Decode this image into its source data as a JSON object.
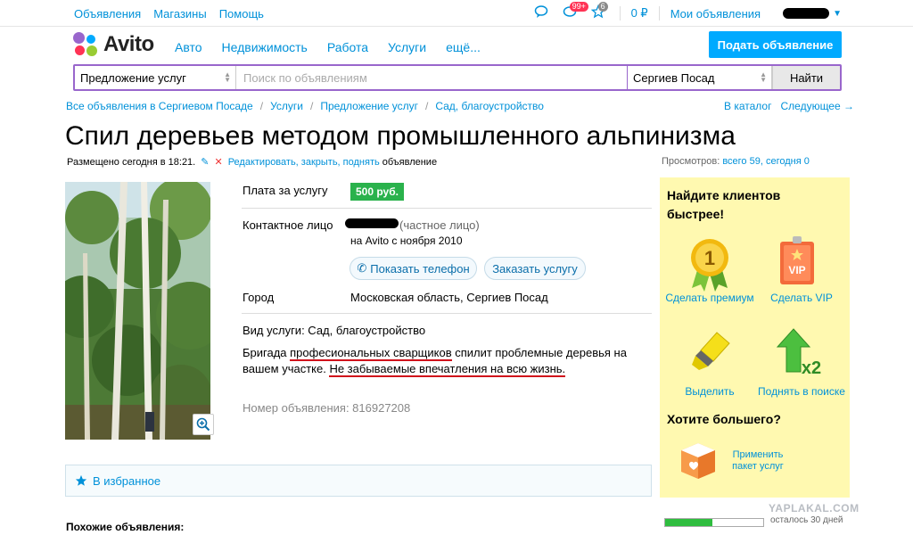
{
  "topbar": {
    "links": [
      "Объявления",
      "Магазины",
      "Помощь"
    ],
    "notif_badge": "99+",
    "fav_badge": "6",
    "balance": "0 ₽",
    "my_ads": "Мои объявления"
  },
  "header": {
    "logo_text": "Avito",
    "nav": [
      "Авто",
      "Недвижимость",
      "Работа",
      "Услуги",
      "ещё..."
    ],
    "post_button": "Подать объявление"
  },
  "search": {
    "category": "Предложение услуг",
    "placeholder": "Поиск по объявлениям",
    "location": "Сергиев Посад",
    "button": "Найти"
  },
  "breadcrumbs": [
    "Все объявления в Сергиевом Посаде",
    "Услуги",
    "Предложение услуг",
    "Сад, благоустройство"
  ],
  "breadcrumbs_right": [
    "В каталог",
    "Следующее →"
  ],
  "ad": {
    "title": "Спил деревьев методом промышленного альпинизма",
    "placed": "Размещено сегодня в 18:21.",
    "edit_link": "Редактировать, закрыть, поднять",
    "edit_suffix": "объявление",
    "views_label": "Просмотров:",
    "views_value": "всего 59, сегодня 0",
    "price_label": "Плата за услугу",
    "price": "500 руб.",
    "contact_label": "Контактное лицо",
    "contact_type": "(частное лицо)",
    "contact_since": "на Avito с ноября 2010",
    "show_phone": "Показать телефон",
    "order": "Заказать услугу",
    "city_label": "Город",
    "city": "Московская область, Сергиев Посад",
    "service_type": "Вид услуги: Сад, благоустройство",
    "desc_p1": "Бригада ",
    "desc_u1": "професиональных сварщиков",
    "desc_p2": " спилит проблемные деревья на вашем участке. ",
    "desc_u2": "Не забываемые впечатления на всю жизнь.",
    "ad_number": "Номер объявления: 816927208",
    "favorites": "В избранное",
    "similar": "Похожие объявления:"
  },
  "promo": {
    "heading": "Найдите клиентов быстрее!",
    "premium": "Сделать премиум",
    "vip": "Сделать VIP",
    "vip_badge": "VIP",
    "highlight": "Выделить",
    "raise": "Поднять в поиске",
    "raise_mult": "x2",
    "heading2": "Хотите большего?",
    "package": "Применить пакет услуг",
    "premium_num": "1"
  },
  "footer": {
    "days_left": "осталось 30 дней",
    "progress": 0.48,
    "watermark": "YAPLAKAL.COM"
  }
}
